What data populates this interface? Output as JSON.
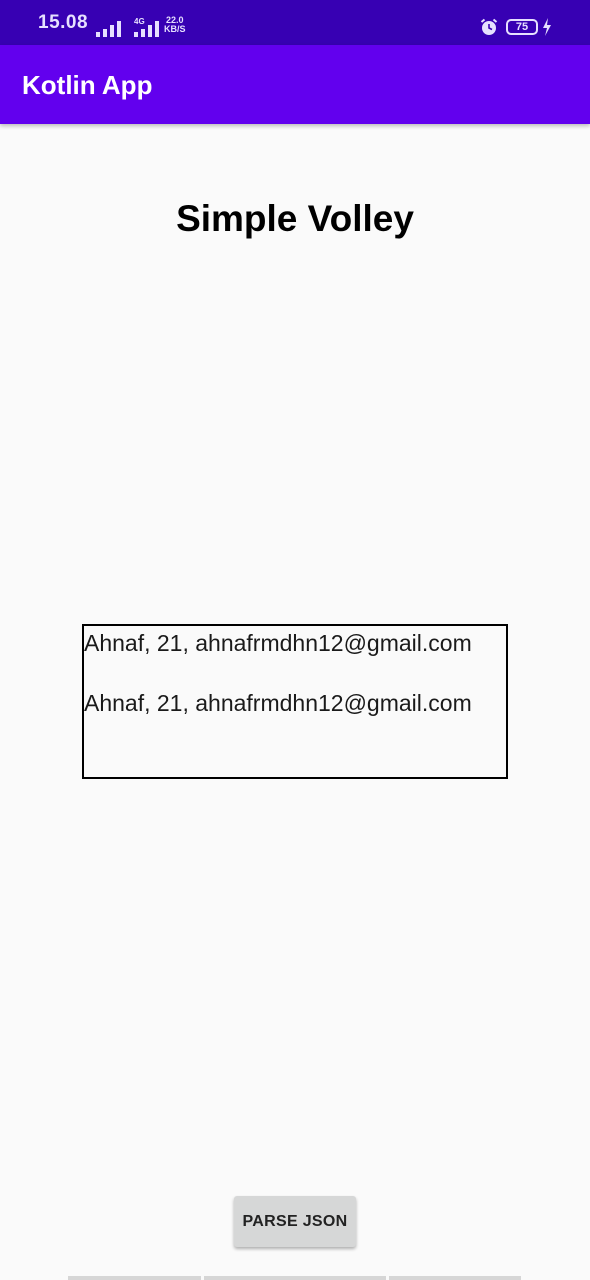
{
  "status_bar": {
    "time": "15.08",
    "network_type": "4G",
    "net_speed_value": "22.0",
    "net_speed_unit": "KB/S",
    "battery_level": "75",
    "icons": [
      "signal-icon",
      "signal-icon",
      "alarm-icon",
      "battery-icon",
      "charging-bolt-icon"
    ],
    "color": "#3700b3"
  },
  "app_bar": {
    "title": "Kotlin App",
    "color": "#6200ee"
  },
  "main": {
    "heading": "Simple Volley",
    "results": [
      "Ahnaf, 21, ahnafrmdhn12@gmail.com",
      "Ahnaf, 21, ahnafrmdhn12@gmail.com"
    ],
    "parse_button_label": "PARSE JSON"
  }
}
